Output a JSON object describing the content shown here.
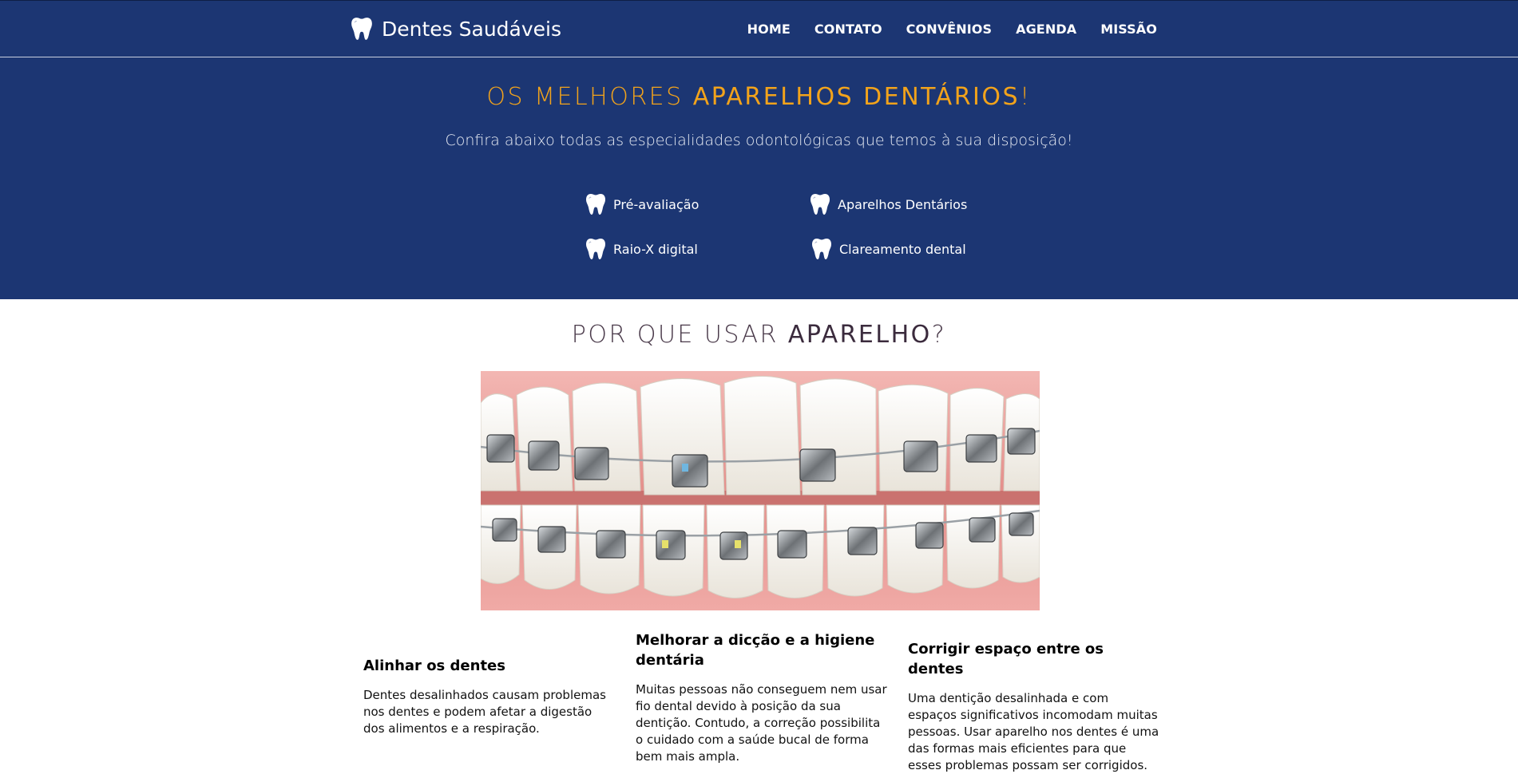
{
  "brand": {
    "name": "Dentes Saudáveis",
    "icon": "tooth-icon"
  },
  "nav": {
    "items": [
      {
        "label": "HOME"
      },
      {
        "label": "CONTATO"
      },
      {
        "label": "CONVÊNIOS"
      },
      {
        "label": "AGENDA"
      },
      {
        "label": "MISSÃO"
      }
    ]
  },
  "hero": {
    "title_light": "OS MELHORES ",
    "title_strong": "APARELHOS DENTÁRIOS",
    "title_end": "!",
    "subtitle": "Confira abaixo todas as especialidades odontológicas que temos à sua disposição!",
    "services": [
      {
        "label": "Pré-avaliação",
        "icon": "tooth-icon"
      },
      {
        "label": "Aparelhos Dentários",
        "icon": "tooth-icon"
      },
      {
        "label": "Raio-X digital",
        "icon": "tooth-icon"
      },
      {
        "label": "Clareamento dental",
        "icon": "tooth-icon"
      }
    ]
  },
  "section": {
    "title_light": "POR QUE USAR ",
    "title_strong": "APARELHO",
    "title_end": "?"
  },
  "cards": [
    {
      "title": "Alinhar os dentes",
      "text": "Dentes desalinhados causam problemas nos dentes e podem afetar a digestão dos alimentos e a respiração."
    },
    {
      "title": "Melhorar a dicção e a higiene dentária",
      "text": "Muitas pessoas não conseguem nem usar fio dental devido à posição da sua dentição. Contudo, a correção possibilita o cuidado com a saúde bucal de forma bem mais ampla."
    },
    {
      "title": "Corrigir espaço entre os dentes",
      "text": "Uma dentição desalinhada e com espaços significativos incomodam muitas pessoas. Usar aparelho nos dentes é uma das formas mais eficientes para que esses problemas possam ser corrigidos."
    }
  ],
  "colors": {
    "navy": "#1c3673",
    "accent": "#f2a31b"
  }
}
